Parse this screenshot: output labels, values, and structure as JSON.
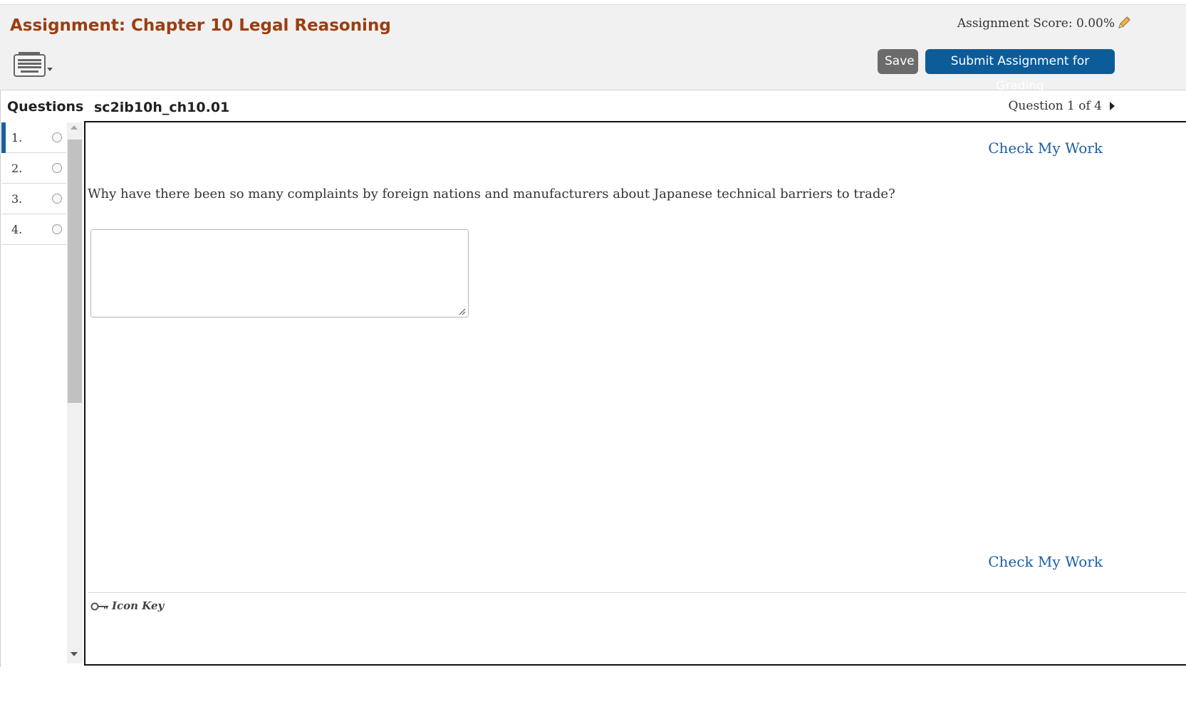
{
  "header": {
    "title": "Assignment: Chapter 10 Legal Reasoning",
    "score_label": "Assignment Score: 0.00%",
    "save_label": "Save",
    "submit_label": "Submit Assignment for Grading"
  },
  "sidebar": {
    "title": "Questions",
    "items": [
      {
        "label": "1."
      },
      {
        "label": "2."
      },
      {
        "label": "3."
      },
      {
        "label": "4."
      }
    ]
  },
  "question": {
    "id": "sc2ib10h_ch10.01",
    "counter": "Question 1 of 4",
    "check_label_top": "Check My Work",
    "check_label_bottom": "Check My Work",
    "text": "Why have there been so many complaints by foreign nations and manufacturers about Japanese technical barriers to trade?",
    "answer_value": ""
  },
  "footer": {
    "icon_key_label": "Icon Key"
  },
  "colors": {
    "title": "#9b3e10",
    "accent": "#1a5fa0",
    "submit": "#0c5c9a",
    "save": "#6b6b6b"
  },
  "icons": [
    "keyboard-icon",
    "pencil-icon",
    "chevron-right-icon",
    "key-icon",
    "scroll-up-icon",
    "scroll-down-icon"
  ]
}
